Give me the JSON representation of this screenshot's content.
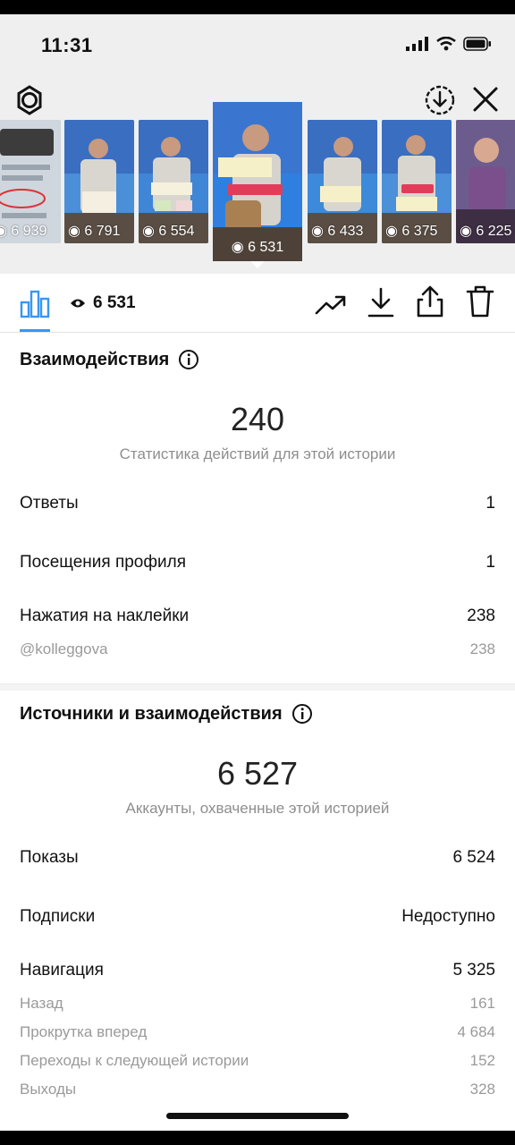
{
  "status_bar": {
    "time": "11:31"
  },
  "stories": [
    {
      "views": "6 939",
      "bg": "#cfd6de"
    },
    {
      "views": "6 791",
      "bg": "#4a8fd8"
    },
    {
      "views": "6 554",
      "bg": "#3f86d6"
    },
    {
      "views": "6 531",
      "bg": "#2f7fe0",
      "sticker": "@KOLLEGGOVA"
    },
    {
      "views": "6 433",
      "bg": "#3c8ad9"
    },
    {
      "views": "6 375",
      "bg": "#4b90d8"
    },
    {
      "views": "6 225",
      "bg": "#6f5f9a"
    }
  ],
  "toolbar": {
    "views": "6 531"
  },
  "interactions": {
    "title": "Взаимодействия",
    "total": "240",
    "caption": "Статистика действий для этой истории",
    "rows": [
      {
        "label": "Ответы",
        "value": "1"
      },
      {
        "label": "Посещения профиля",
        "value": "1"
      },
      {
        "label": "Нажатия на наклейки",
        "value": "238"
      }
    ],
    "sticker_row": {
      "label": "@kolleggova",
      "value": "238"
    }
  },
  "discovery": {
    "title": "Источники и взаимодействия",
    "total": "6 527",
    "caption": "Аккаунты, охваченные этой историей",
    "rows": [
      {
        "label": "Показы",
        "value": "6 524"
      },
      {
        "label": "Подписки",
        "value": "Недоступно"
      },
      {
        "label": "Навигация",
        "value": "5 325"
      }
    ],
    "nav_rows": [
      {
        "label": "Назад",
        "value": "161"
      },
      {
        "label": "Прокрутка вперед",
        "value": "4 684"
      },
      {
        "label": "Переходы к следующей истории",
        "value": "152"
      },
      {
        "label": "Выходы",
        "value": "328"
      }
    ]
  }
}
